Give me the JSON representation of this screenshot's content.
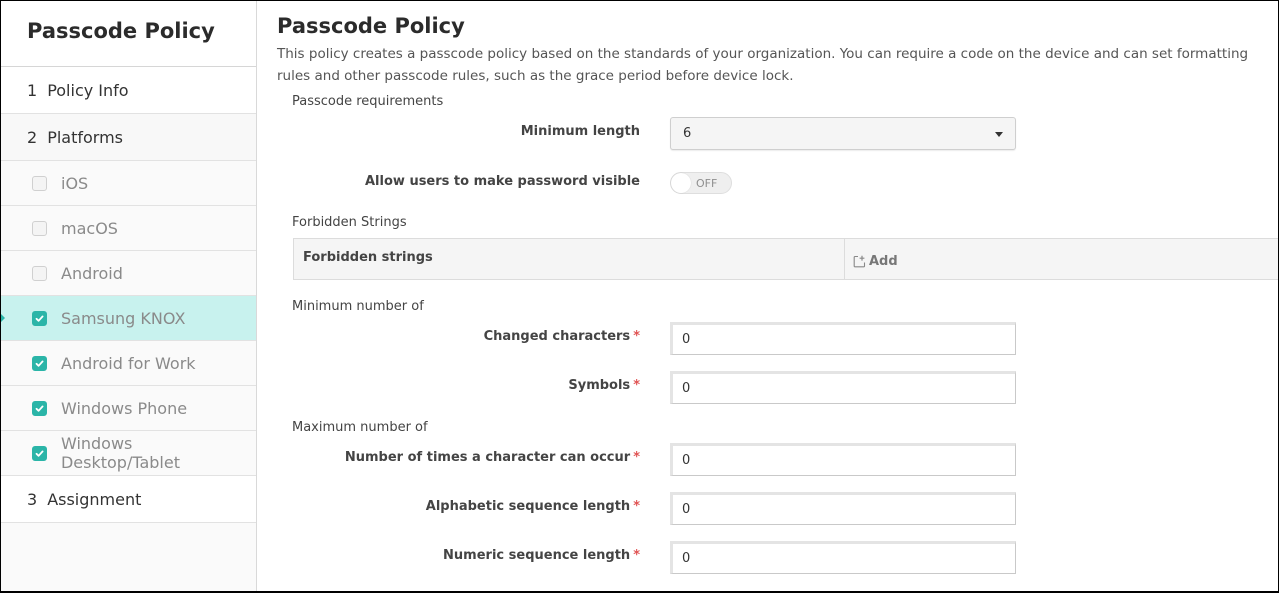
{
  "sidebar": {
    "title": "Passcode Policy",
    "steps": [
      {
        "num": "1",
        "label": "Policy Info"
      },
      {
        "num": "2",
        "label": "Platforms"
      },
      {
        "num": "3",
        "label": "Assignment"
      }
    ],
    "platforms": [
      {
        "label": "iOS",
        "checked": false,
        "active": false
      },
      {
        "label": "macOS",
        "checked": false,
        "active": false
      },
      {
        "label": "Android",
        "checked": false,
        "active": false
      },
      {
        "label": "Samsung KNOX",
        "checked": true,
        "active": true
      },
      {
        "label": "Android for Work",
        "checked": true,
        "active": false
      },
      {
        "label": "Windows Phone",
        "checked": true,
        "active": false
      },
      {
        "label": "Windows Desktop/Tablet",
        "checked": true,
        "active": false
      }
    ]
  },
  "main": {
    "title": "Passcode Policy",
    "description": "This policy creates a passcode policy based on the standards of your organization. You can require a code on the device and can set formatting rules and other passcode rules, such as the grace period before device lock.",
    "passcode_requirements": {
      "section_label": "Passcode requirements",
      "minimum_length": {
        "label": "Minimum length",
        "value": "6"
      },
      "password_visible": {
        "label": "Allow users to make password visible",
        "state": "OFF"
      }
    },
    "forbidden_strings": {
      "section_label": "Forbidden Strings",
      "column_header": "Forbidden strings",
      "add_label": "Add"
    },
    "minimum_number_of": {
      "section_label": "Minimum number of",
      "fields": [
        {
          "label": "Changed characters",
          "required": "*",
          "value": "0"
        },
        {
          "label": "Symbols",
          "required": "*",
          "value": "0"
        }
      ]
    },
    "maximum_number_of": {
      "section_label": "Maximum number of",
      "fields": [
        {
          "label": "Number of times a character can occur",
          "required": "*",
          "value": "0"
        },
        {
          "label": "Alphabetic sequence length",
          "required": "*",
          "value": "0"
        },
        {
          "label": "Numeric sequence length",
          "required": "*",
          "value": "0"
        }
      ]
    }
  },
  "colors": {
    "accent": "#2bb5a8",
    "active_row_bg": "#c8f2ee",
    "required": "#e05353"
  }
}
